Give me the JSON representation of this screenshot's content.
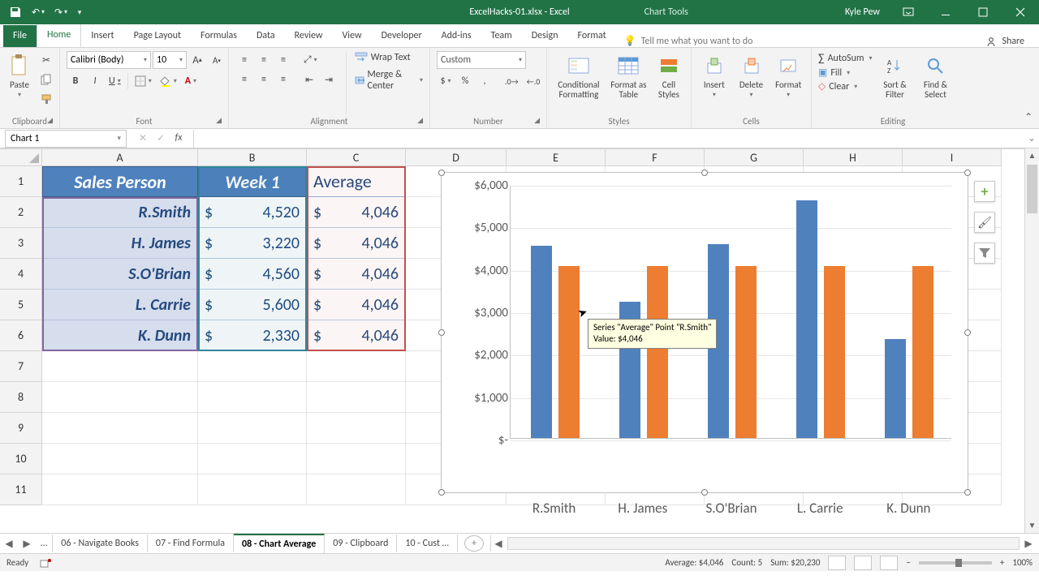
{
  "titlebar": {
    "filename": "ExcelHacks-01.xlsx - Excel",
    "chart_tools": "Chart Tools",
    "user": "Kyle Pew"
  },
  "tabs": {
    "file": "File",
    "home": "Home",
    "insert": "Insert",
    "page_layout": "Page Layout",
    "formulas": "Formulas",
    "data": "Data",
    "review": "Review",
    "view": "View",
    "developer": "Developer",
    "addins": "Add-ins",
    "team": "Team",
    "design": "Design",
    "format": "Format",
    "tellme": "Tell me what you want to do",
    "share": "Share"
  },
  "ribbon": {
    "clipboard": {
      "paste": "Paste",
      "label": "Clipboard"
    },
    "font": {
      "name": "Calibri (Body)",
      "size": "10",
      "label": "Font"
    },
    "alignment": {
      "wrap": "Wrap Text",
      "merge": "Merge & Center",
      "label": "Alignment"
    },
    "number": {
      "style": "Custom",
      "label": "Number"
    },
    "styles": {
      "cond": "Conditional\nFormatting",
      "table": "Format as\nTable",
      "cell": "Cell\nStyles",
      "label": "Styles"
    },
    "cells": {
      "insert": "Insert",
      "delete": "Delete",
      "format": "Format",
      "label": "Cells"
    },
    "editing": {
      "sum": "AutoSum",
      "fill": "Fill",
      "clear": "Clear",
      "sort": "Sort &\nFilter",
      "find": "Find &\nSelect",
      "label": "Editing"
    }
  },
  "namebox": "Chart 1",
  "columns": [
    "A",
    "B",
    "C",
    "D",
    "E",
    "F",
    "G",
    "H",
    "I"
  ],
  "rows": [
    "1",
    "2",
    "3",
    "4",
    "5",
    "6",
    "7",
    "8",
    "9",
    "10",
    "11"
  ],
  "table": {
    "headers": {
      "A": "Sales Person",
      "B": "Week 1",
      "C": "Average"
    },
    "rows": [
      {
        "name": "R.Smith",
        "week1": "4,520",
        "avg": "4,046"
      },
      {
        "name": "H. James",
        "week1": "3,220",
        "avg": "4,046"
      },
      {
        "name": "S.O'Brian",
        "week1": "4,560",
        "avg": "4,046"
      },
      {
        "name": "L. Carrie",
        "week1": "5,600",
        "avg": "4,046"
      },
      {
        "name": "K. Dunn",
        "week1": "2,330",
        "avg": "4,046"
      }
    ]
  },
  "chart_data": {
    "type": "bar",
    "categories": [
      "R.Smith",
      "H. James",
      "S.O'Brian",
      "L. Carrie",
      "K. Dunn"
    ],
    "series": [
      {
        "name": "Week 1",
        "values": [
          4520,
          3220,
          4560,
          5600,
          2330
        ]
      },
      {
        "name": "Average",
        "values": [
          4046,
          4046,
          4046,
          4046,
          4046
        ]
      }
    ],
    "ylabels": [
      "$6,000",
      "$5,000",
      "$4,000",
      "$3,000",
      "$2,000",
      "$1,000",
      "$-"
    ],
    "ylim": [
      0,
      6000
    ]
  },
  "tooltip": {
    "line1": "Series \"Average\" Point \"R.Smith\"",
    "line2": "Value: $4,046"
  },
  "sheettabs": {
    "t1": "06 - Navigate Books",
    "t2": "07 - Find Formula",
    "t3": "08 - Chart Average",
    "t4": "09 - Clipboard",
    "t5": "10 - Cust …"
  },
  "status": {
    "ready": "Ready",
    "average": "Average: $4,046",
    "count": "Count: 5",
    "sum": "Sum: $20,230",
    "zoom": "100%"
  }
}
